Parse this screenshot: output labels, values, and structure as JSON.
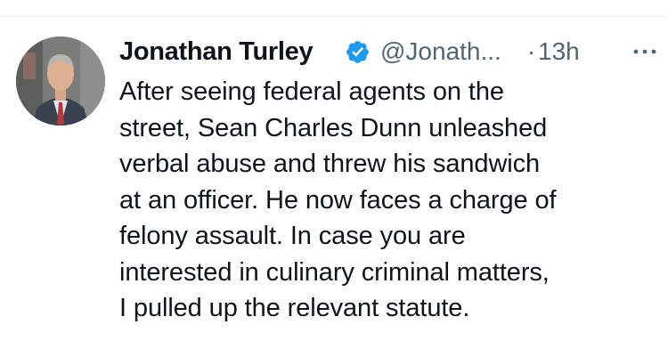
{
  "tweet": {
    "author_name": "Jonathan Turley",
    "handle": "@Jonath...",
    "separator": "·",
    "time": "13h",
    "text_lines": [
      "After seeing federal agents on the",
      "street, Sean Charles Dunn unleashed",
      "verbal abuse and threw his sandwich",
      "at an officer. He now faces a charge of",
      "felony assault. In case you are",
      "interested in culinary criminal matters,",
      "I pulled up the relevant statute."
    ]
  },
  "icons": {
    "verified": "verified-badge-icon",
    "more": "more-options-icon"
  },
  "colors": {
    "text_primary": "#0f1419",
    "text_secondary": "#536471",
    "verified_blue": "#1d9bf0",
    "divider": "#eff3f4"
  }
}
